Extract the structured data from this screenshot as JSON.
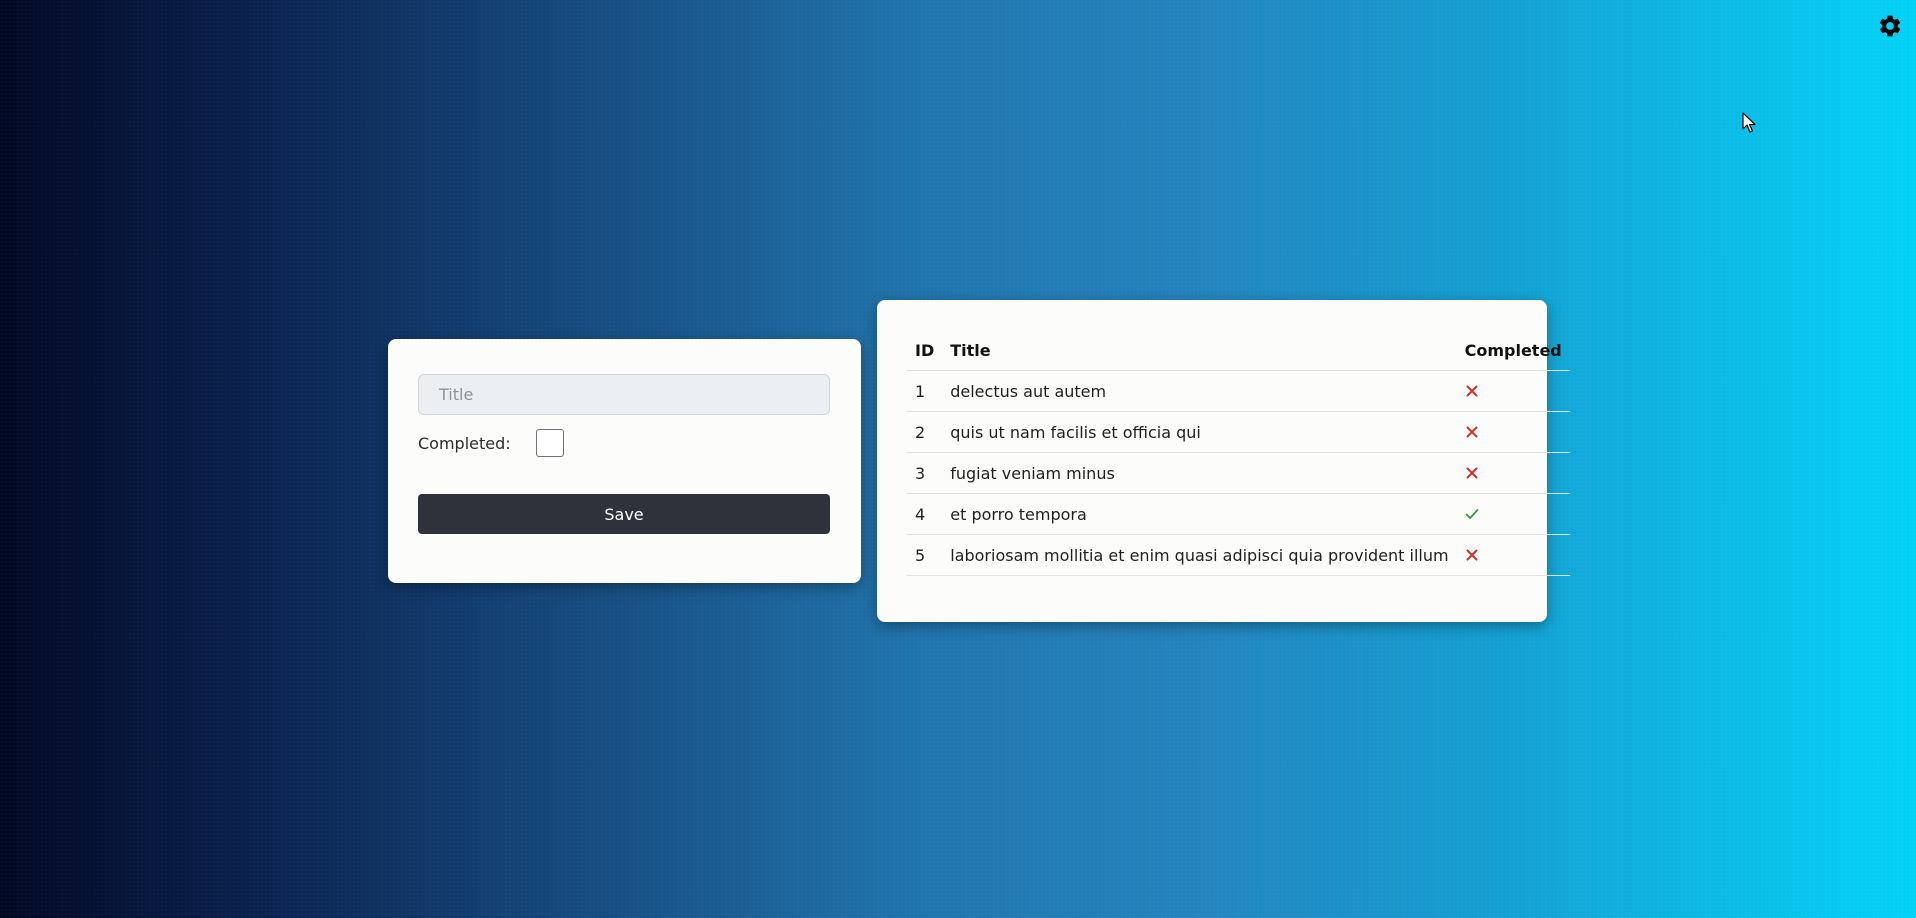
{
  "form": {
    "title_placeholder": "Title",
    "title_value": "",
    "completed_label": "Completed:",
    "completed_checked": false,
    "save_label": "Save"
  },
  "table": {
    "headers": {
      "id": "ID",
      "title": "Title",
      "completed": "Completed"
    },
    "rows": [
      {
        "id": "1",
        "title": "delectus aut autem",
        "completed": false,
        "status_icon": "cross-icon"
      },
      {
        "id": "2",
        "title": "quis ut nam facilis et officia qui",
        "completed": false,
        "status_icon": "cross-icon"
      },
      {
        "id": "3",
        "title": "fugiat veniam minus",
        "completed": false,
        "status_icon": "cross-icon"
      },
      {
        "id": "4",
        "title": "et porro tempora",
        "completed": true,
        "status_icon": "check-icon"
      },
      {
        "id": "5",
        "title": "laboriosam mollitia et enim quasi adipisci quia provident illum",
        "completed": false,
        "status_icon": "cross-icon"
      }
    ]
  },
  "icons": {
    "settings": "gear-icon"
  },
  "colors": {
    "gradient_start": "#020824",
    "gradient_end": "#02d2f5",
    "card_bg": "#fcfcfa",
    "button_bg": "#2d323b",
    "cross": "#d32f2f",
    "check": "#2e9e3e"
  }
}
